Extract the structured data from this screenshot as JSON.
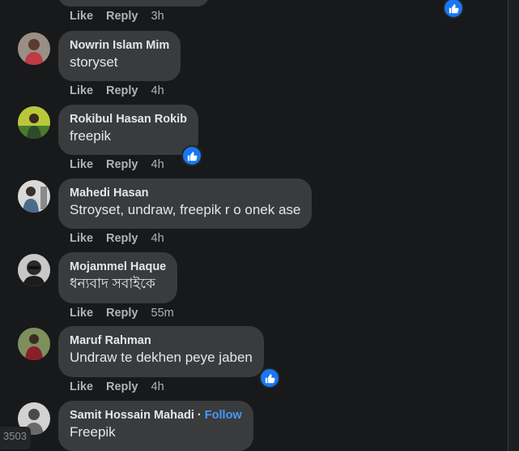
{
  "actions": {
    "like": "Like",
    "reply": "Reply"
  },
  "top": {
    "time": "3h"
  },
  "comments": [
    {
      "author": "Nowrin Islam Mim",
      "text": "storyset",
      "time": "4h",
      "follow": "",
      "liked": false
    },
    {
      "author": "Rokibul Hasan Rokib",
      "text": "freepik",
      "time": "4h",
      "follow": "",
      "liked": true
    },
    {
      "author": "Mahedi Hasan",
      "text": "Stroyset, undraw, freepik r o onek ase",
      "time": "4h",
      "follow": "",
      "liked": false
    },
    {
      "author": "Mojammel Haque",
      "text": "ধন্যবাদ সবাইকে",
      "time": "55m",
      "follow": "",
      "liked": false
    },
    {
      "author": "Maruf Rahman",
      "text": "Undraw te dekhen peye jaben",
      "time": "4h",
      "follow": "",
      "liked": true
    },
    {
      "author": "Samit Hossain Mahadi",
      "text": "Freepik",
      "time": "",
      "follow": "Follow",
      "liked": false
    }
  ],
  "side_counter": "3503",
  "colors": {
    "background": "#18191a",
    "bubble": "#3a3b3c",
    "accent": "#1877f2",
    "link": "#4599ff"
  },
  "icons": {
    "like_badge": "thumbs-up-icon"
  }
}
